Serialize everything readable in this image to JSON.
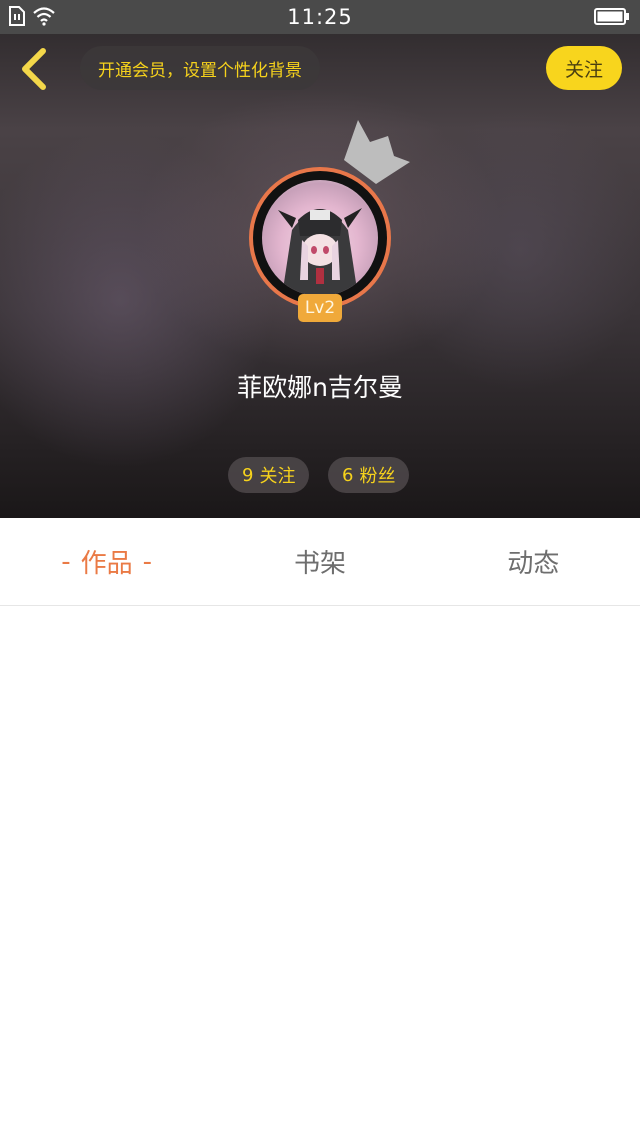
{
  "status_bar": {
    "time": "11:25",
    "icons": [
      "sim-icon",
      "wifi-icon",
      "battery-icon"
    ]
  },
  "header": {
    "back_icon": "chevron-left-icon",
    "vip_banner": "开通会员，设置个性化背景",
    "follow_label": "关注",
    "accent_color": "#f8d51d"
  },
  "profile": {
    "level": "Lv2",
    "username": "菲欧娜n吉尔曼",
    "following_count": "9",
    "following_label": "关注",
    "fans_count": "6",
    "fans_label": "粉丝"
  },
  "tabs": [
    {
      "label": "作品",
      "active": true,
      "dash": "-"
    },
    {
      "label": "书架",
      "active": false
    },
    {
      "label": "动态",
      "active": false
    }
  ],
  "colors": {
    "active_tab": "#ea7a45",
    "inactive_tab": "#6e6e6e",
    "avatar_ring": "#e8774a",
    "level_badge": "#f0a93a"
  }
}
